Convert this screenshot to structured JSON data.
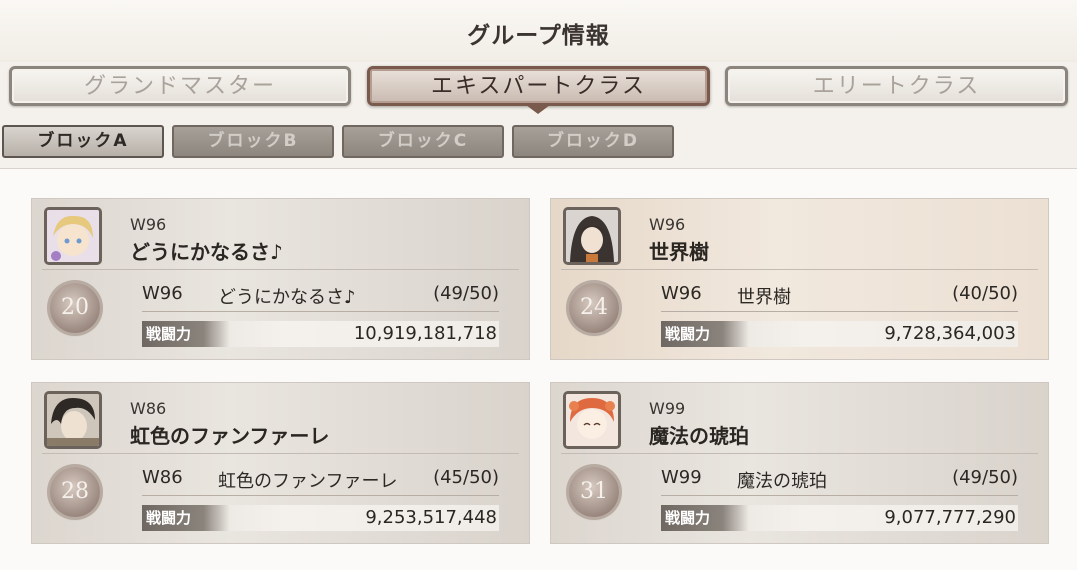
{
  "header": {
    "title": "グループ情報"
  },
  "class_tabs": [
    {
      "label": "グランドマスター"
    },
    {
      "label": "エキスパートクラス"
    },
    {
      "label": "エリートクラス"
    }
  ],
  "block_tabs": [
    {
      "label": "ブロックA"
    },
    {
      "label": "ブロックB"
    },
    {
      "label": "ブロックC"
    },
    {
      "label": "ブロックD"
    }
  ],
  "guilds": [
    {
      "server": "W96",
      "name": "どうにかなるさ♪",
      "rank": "20",
      "members": "(49/50)",
      "power_label": "戦闘力",
      "power": "10,919,181,718"
    },
    {
      "server": "W96",
      "name": "世界樹",
      "rank": "24",
      "members": "(40/50)",
      "power_label": "戦闘力",
      "power": "9,728,364,003"
    },
    {
      "server": "W86",
      "name": "虹色のファンファーレ",
      "rank": "28",
      "members": "(45/50)",
      "power_label": "戦闘力",
      "power": "9,253,517,448"
    },
    {
      "server": "W99",
      "name": "魔法の琥珀",
      "rank": "31",
      "members": "(49/50)",
      "power_label": "戦闘力",
      "power": "9,077,777,290"
    }
  ]
}
